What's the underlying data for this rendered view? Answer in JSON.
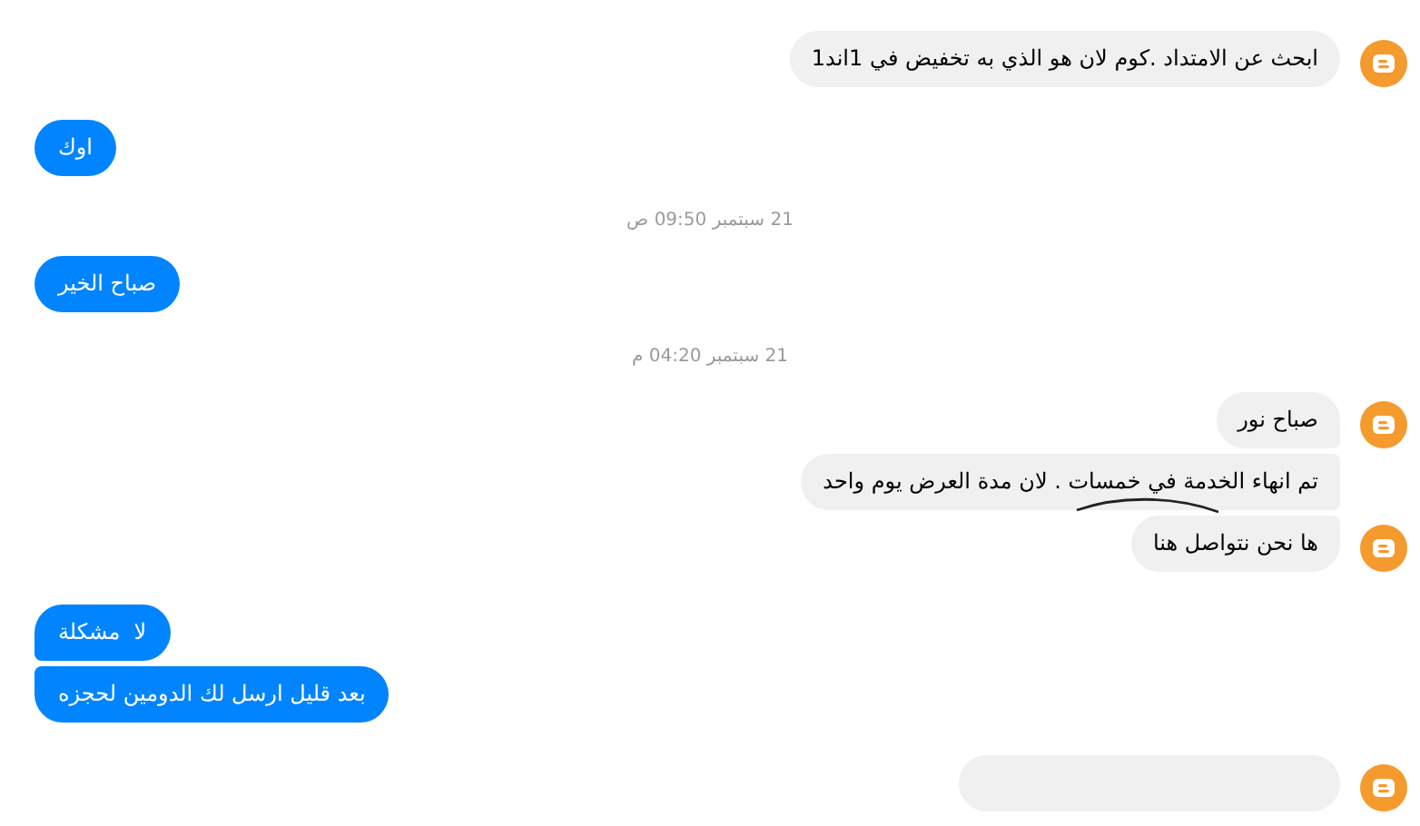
{
  "messages": [
    {
      "kind": "incoming",
      "text": "ابحث عن الامتداد .كوم لان هو الذي به تخفيض في 1اند1",
      "avatar": true
    },
    {
      "kind": "outgoing",
      "text": "اوك"
    },
    {
      "kind": "date",
      "text": "21 سبتمبر 09:50 ص"
    },
    {
      "kind": "outgoing",
      "text": "صباح الخير"
    },
    {
      "kind": "date",
      "text": "21 سبتمبر 04:20 م"
    },
    {
      "kind": "incoming",
      "text": "صباح نور",
      "avatar": true
    },
    {
      "kind": "incoming",
      "text": "تم انهاء الخدمة في خمسات . لان مدة العرض يوم واحد",
      "avatar": false,
      "scribble": true
    },
    {
      "kind": "incoming",
      "text": "ها نحن نتواصل هنا",
      "avatar": true
    },
    {
      "kind": "outgoing",
      "text": "لا  مشكلة"
    },
    {
      "kind": "outgoing",
      "text": "بعد قليل ارسل لك الدومين لحجزه"
    },
    {
      "kind": "incoming",
      "avatar": true
    }
  ]
}
